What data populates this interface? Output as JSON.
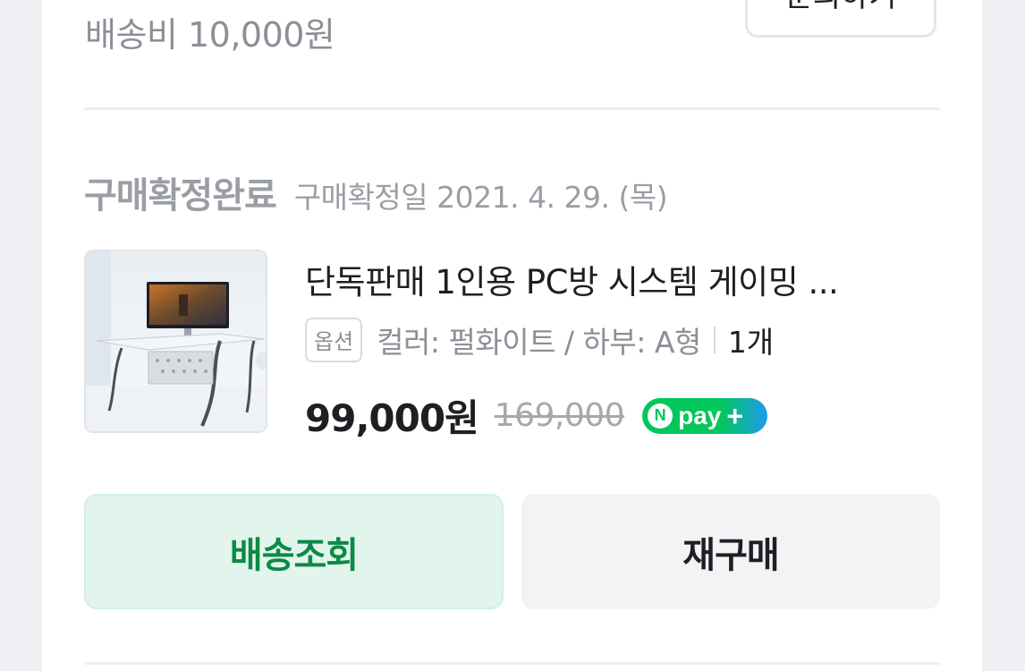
{
  "order": {
    "shipping_fee": "배송비 10,000원",
    "inquiry_label": "문의하기",
    "status_label": "구매확정완료",
    "status_date": "구매확정일 2021. 4. 29. (목)"
  },
  "product": {
    "title": "단독판매 1인용 PC방 시스템 게이밍 ...",
    "option_tag": "옵션",
    "option_text": "컬러: 펄화이트 / 하부: A형",
    "quantity": "1개",
    "sale_price": "99,000원",
    "original_price": "169,000",
    "pay_badge": {
      "n": "N",
      "text": "pay",
      "plus": "+"
    }
  },
  "actions": {
    "track_label": "배송조회",
    "rebuy_label": "재구매"
  },
  "colors": {
    "accent_green": "#03c75a",
    "track_text": "#0c8a46",
    "track_bg": "#e2f5ec"
  }
}
